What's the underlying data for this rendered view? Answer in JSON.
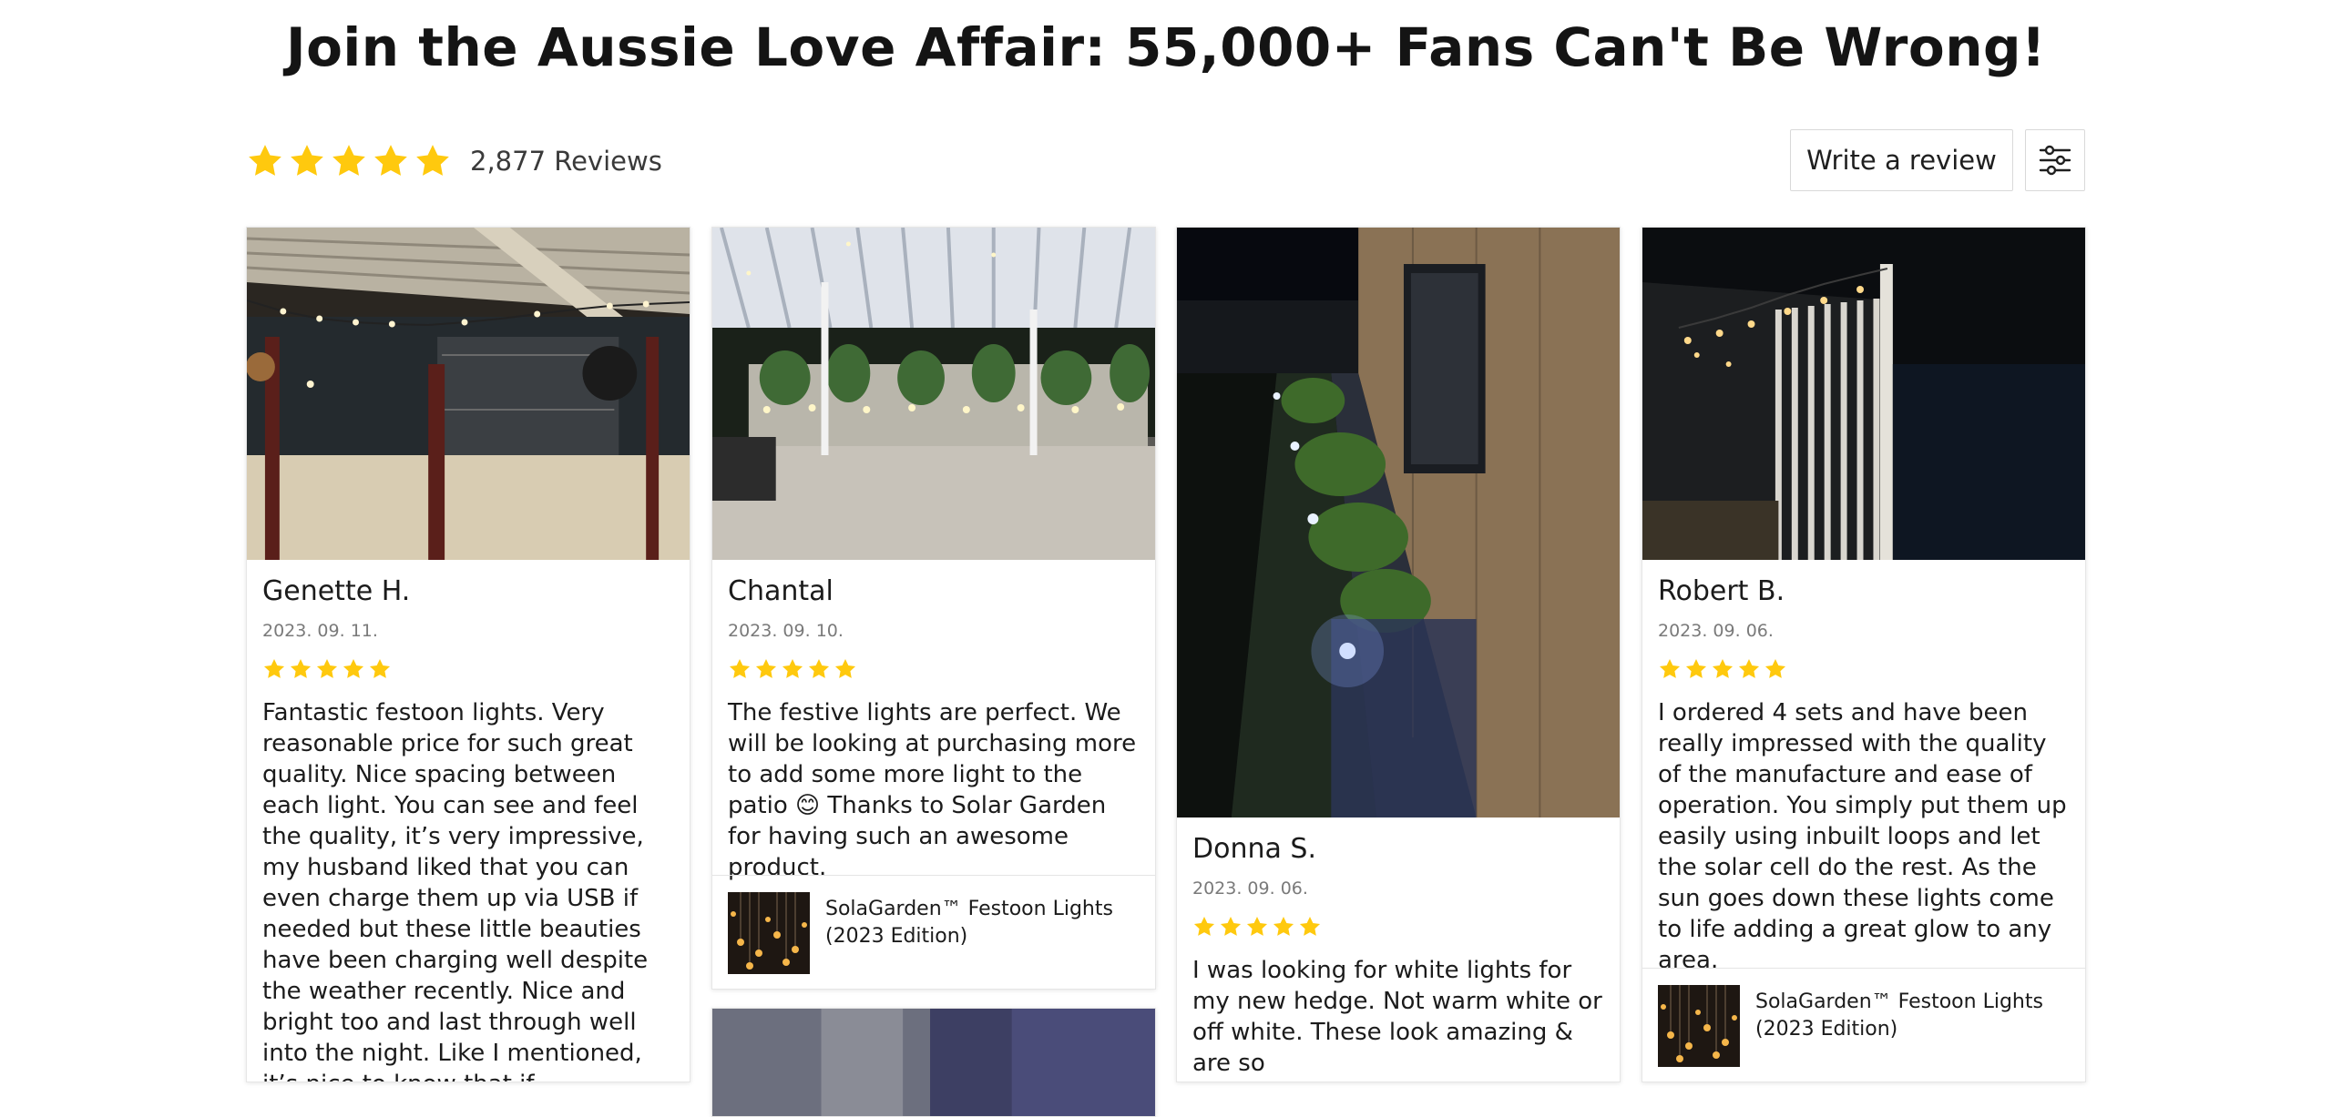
{
  "headline": "Join the Aussie Love Affair: 55,000+ Fans Can't Be Wrong!",
  "summary": {
    "rating": 5,
    "reviews_label": "2,877 Reviews"
  },
  "actions": {
    "write_review_label": "Write a review",
    "filter_icon": "sliders-icon"
  },
  "colors": {
    "star": "#FFC90E",
    "text": "#1f1f1f",
    "muted": "#7a7a7a",
    "border": "#e6e6e6"
  },
  "reviews": [
    {
      "author": "Genette H.",
      "date": "2023. 09. 11.",
      "rating": 5,
      "text": "Fantastic festoon lights. Very reasonable price for such great quality. Nice spacing between each light. You can see and feel the quality, it’s very impressive, my husband liked that you can even charge them up via USB if needed but these little beauties have been charging well despite the weather recently. Nice and bright too and last through well into the night. Like I mentioned, it’s nice to know that if"
    },
    {
      "author": "Chantal",
      "date": "2023. 09. 10.",
      "rating": 5,
      "text": "The festive lights are perfect. We will be looking at purchasing more to add some more light to the patio 😊 Thanks to Solar Garden for having such an awesome product.",
      "product": "SolaGarden™ Festoon Lights (2023 Edition)"
    },
    {
      "author": "Donna S.",
      "date": "2023. 09. 06.",
      "rating": 5,
      "text": "I was looking for white lights for my new hedge.  Not warm white or off white.  These look amazing & are so"
    },
    {
      "author": "Robert B.",
      "date": "2023. 09. 06.",
      "rating": 5,
      "text": "I ordered 4 sets and have been really impressed with the quality of the manufacture and ease of operation.  You simply put them up easily using inbuilt loops and let the solar cell do the rest.  As the sun goes down these lights come to life adding a great glow to any area.",
      "product": "SolaGarden™ Festoon Lights (2023 Edition)"
    }
  ]
}
